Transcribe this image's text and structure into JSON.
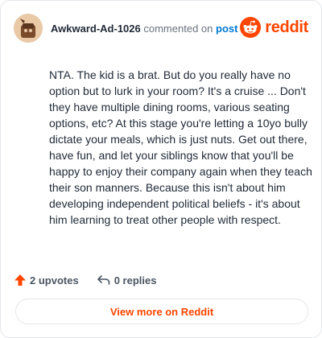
{
  "header": {
    "username": "Awkward-Ad-1026",
    "commented_on_text": "commented on",
    "post_link": "post",
    "brand_name": "reddit"
  },
  "comment": {
    "body": "NTA. The kid is a brat. But do you really have no option but to lurk in your room? It's a cruise ... Don't they have multiple dining rooms, various seating options, etc? At this stage you're letting a 10yo bully dictate your meals, which is just nuts. Get out there, have fun, and let your siblings know that you'll be happy to enjoy their company again when they teach their son manners. Because this isn't about him developing independent political beliefs - it's about him learning to treat other people with respect."
  },
  "actions": {
    "upvotes": "2 upvotes",
    "replies": "0 replies"
  },
  "cta": {
    "label": "View more on Reddit"
  },
  "icons": {
    "avatar": "snoo-avatar-icon",
    "brand": "reddit-logo-icon",
    "upvote": "upvote-arrow-icon",
    "reply": "reply-arrow-icon"
  },
  "colors": {
    "brand": "#ff4500",
    "link": "#0079d3",
    "text": "#1f2937",
    "muted": "#6b7280"
  }
}
